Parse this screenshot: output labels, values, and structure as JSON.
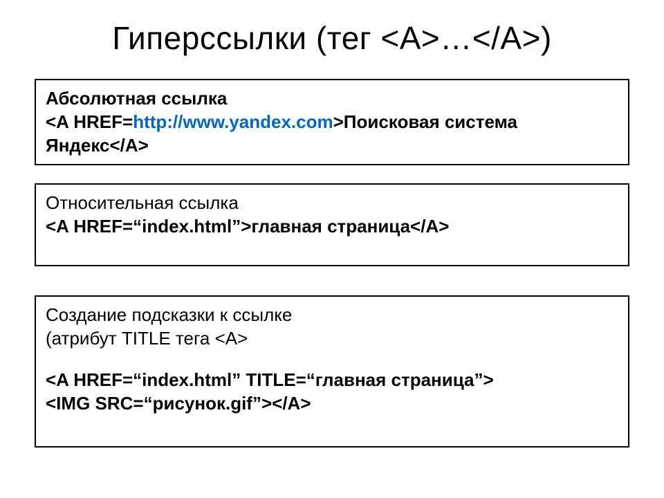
{
  "title": "Гиперссылки (тег <A>…</A>)",
  "box1": {
    "heading": "Абсолютная ссылка",
    "code_before": "<A HREF=",
    "code_url": "http://www.yandex.com",
    "code_after": ">Поисковая система Яндекс</A>"
  },
  "box2": {
    "heading": "Относительная ссылка",
    "code": "<A HREF=“index.html”>главная страница</A>"
  },
  "box3": {
    "line1": "Создание подсказки к ссылке",
    "line2": "(атрибут TITLE тега <A>",
    "code1": "<A HREF=“index.html” TITLE=“главная страница”>",
    "code2": "<IMG SRC=“рисунок.gif”></A>"
  }
}
